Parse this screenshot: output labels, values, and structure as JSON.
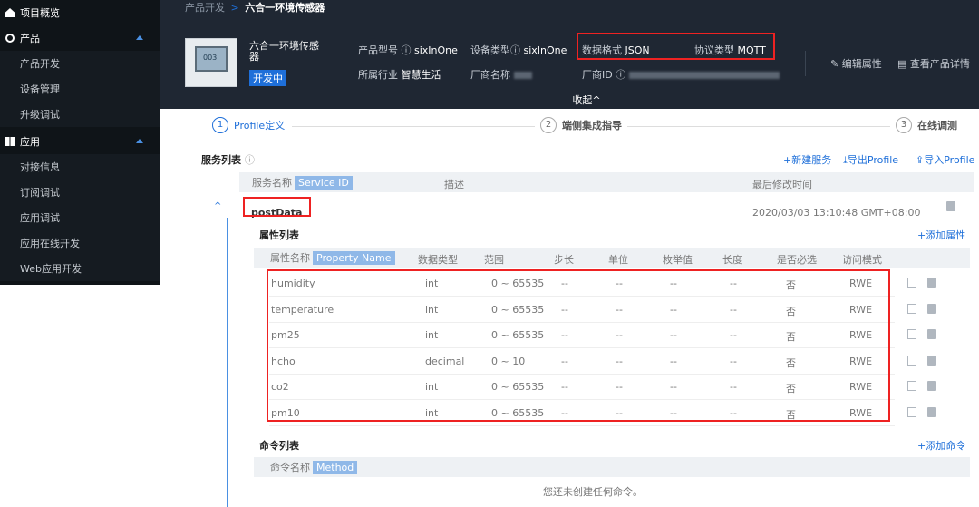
{
  "sidebar": {
    "items": [
      {
        "label": "项目概览",
        "kind": "top"
      },
      {
        "label": "产品",
        "kind": "top"
      },
      {
        "label": "产品开发",
        "kind": "sub"
      },
      {
        "label": "设备管理",
        "kind": "sub"
      },
      {
        "label": "升级调试",
        "kind": "sub"
      },
      {
        "label": "应用",
        "kind": "top"
      },
      {
        "label": "对接信息",
        "kind": "sub"
      },
      {
        "label": "订阅调试",
        "kind": "sub"
      },
      {
        "label": "应用调试",
        "kind": "sub"
      },
      {
        "label": "应用在线开发",
        "kind": "sub"
      },
      {
        "label": "Web应用开发",
        "kind": "sub"
      }
    ]
  },
  "breadcrumb": {
    "parent": "产品开发",
    "sep": ">",
    "current": "六合一环境传感器"
  },
  "product": {
    "name": "六合一环境传感器",
    "thumb_text": "003",
    "status": "开发中",
    "model_label": "产品型号",
    "model": "sixInOne",
    "device_type_label": "设备类型",
    "device_type": "sixInOne",
    "data_format_label": "数据格式",
    "data_format": "JSON",
    "protocol_label": "协议类型",
    "protocol": "MQTT",
    "industry_label": "所属行业",
    "industry": "智慧生活",
    "vendor_label": "厂商名称",
    "vendor_id_label": "厂商ID"
  },
  "header_links": {
    "edit": "编辑属性",
    "detail": "查看产品详情"
  },
  "collapse_label": "收起^",
  "steps": [
    {
      "num": "1",
      "label": "Profile定义"
    },
    {
      "num": "2",
      "label": "端侧集成指导"
    },
    {
      "num": "3",
      "label": "在线调测"
    }
  ],
  "service_list": {
    "title": "服务列表",
    "actions": {
      "new": "+新建服务",
      "export": "导出Profile",
      "import": "导入Profile"
    },
    "headers": {
      "name": "服务名称",
      "id_tag": "Service ID",
      "desc": "描述",
      "modified": "最后修改时间"
    },
    "service": {
      "name": "postData",
      "modified": "2020/03/03 13:10:48 GMT+08:00"
    }
  },
  "property_list": {
    "title": "属性列表",
    "add": "+添加属性",
    "headers": {
      "name": "属性名称",
      "tag": "Property Name",
      "type": "数据类型",
      "range": "范围",
      "step": "步长",
      "unit": "单位",
      "enum": "枚举值",
      "length": "长度",
      "required": "是否必选",
      "access": "访问模式"
    },
    "rows": [
      {
        "name": "humidity",
        "type": "int",
        "range": "0 ~ 65535",
        "step": "--",
        "unit": "--",
        "enum": "--",
        "length": "--",
        "required": "否",
        "access": "RWE"
      },
      {
        "name": "temperature",
        "type": "int",
        "range": "0 ~ 65535",
        "step": "--",
        "unit": "--",
        "enum": "--",
        "length": "--",
        "required": "否",
        "access": "RWE"
      },
      {
        "name": "pm25",
        "type": "int",
        "range": "0 ~ 65535",
        "step": "--",
        "unit": "--",
        "enum": "--",
        "length": "--",
        "required": "否",
        "access": "RWE"
      },
      {
        "name": "hcho",
        "type": "decimal",
        "range": "0 ~ 10",
        "step": "--",
        "unit": "--",
        "enum": "--",
        "length": "--",
        "required": "否",
        "access": "RWE"
      },
      {
        "name": "co2",
        "type": "int",
        "range": "0 ~ 65535",
        "step": "--",
        "unit": "--",
        "enum": "--",
        "length": "--",
        "required": "否",
        "access": "RWE"
      },
      {
        "name": "pm10",
        "type": "int",
        "range": "0 ~ 65535",
        "step": "--",
        "unit": "--",
        "enum": "--",
        "length": "--",
        "required": "否",
        "access": "RWE"
      }
    ]
  },
  "command_list": {
    "title": "命令列表",
    "add": "+添加命令",
    "headers": {
      "name": "命令名称",
      "tag": "Method"
    },
    "empty": "您还未创建任何命令。"
  },
  "colors": {
    "accent": "#1e6fd9",
    "sidebar": "#0f1418",
    "header": "#1f2733",
    "highlight": "#e22222"
  }
}
